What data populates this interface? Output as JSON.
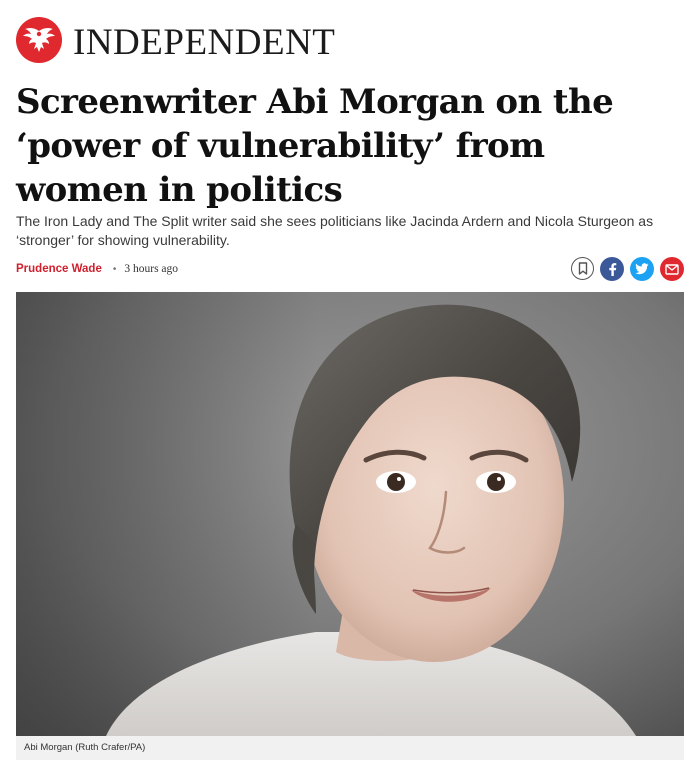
{
  "masthead": {
    "wordmark": "INDEPENDENT",
    "logo_icon": "eagle-logo-icon",
    "brand_color": "#e0282f"
  },
  "article": {
    "headline": "Screenwriter Abi Morgan on the ‘power of vulnerability’ from women in politics",
    "standfirst": "The Iron Lady and The Split writer said she sees politicians like Jacinda Ardern and Nicola Sturgeon as ‘stronger’ for showing vulnerability.",
    "author": "Prudence Wade",
    "separator": "•",
    "published": "3 hours ago",
    "author_color": "#d0202e"
  },
  "share": {
    "buttons": [
      {
        "icon": "bookmark-icon",
        "color": "#ffffff"
      },
      {
        "icon": "facebook-icon",
        "color": "#3b5998"
      },
      {
        "icon": "twitter-icon",
        "color": "#1da1f2"
      },
      {
        "icon": "email-icon",
        "color": "#e0282f"
      }
    ]
  },
  "hero_image": {
    "caption": "Abi Morgan (Ruth Crafer/PA)"
  }
}
